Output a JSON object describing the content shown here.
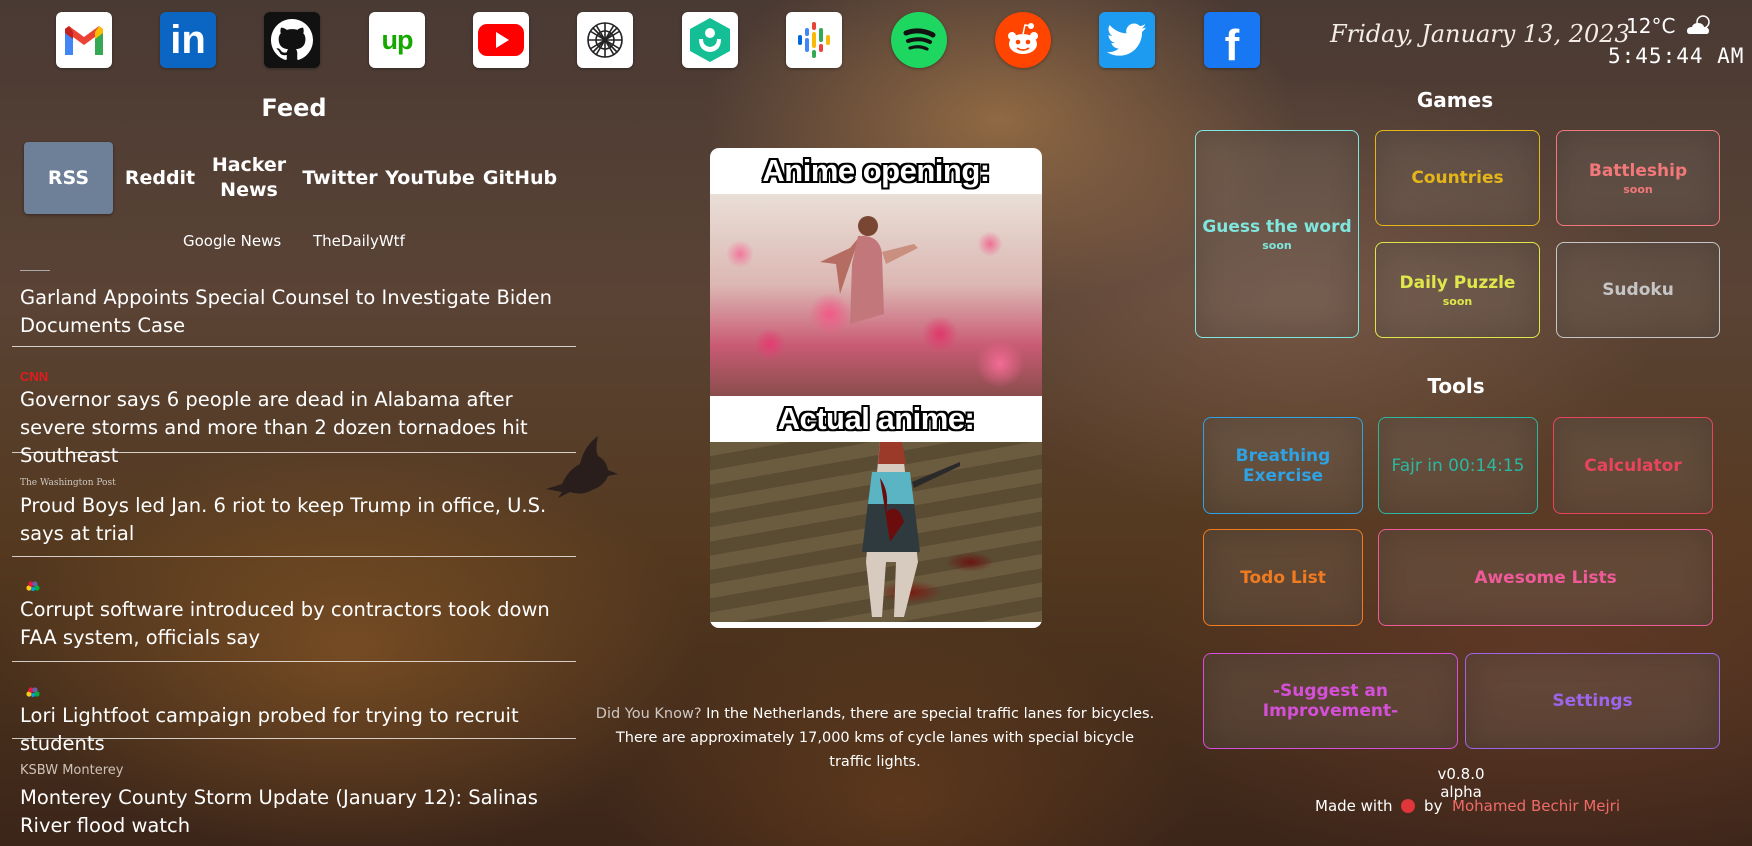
{
  "top_bar": {
    "apps": [
      {
        "name": "Gmail",
        "icon": "gmail-icon"
      },
      {
        "name": "LinkedIn",
        "icon": "linkedin-icon"
      },
      {
        "name": "GitHub",
        "icon": "github-icon"
      },
      {
        "name": "Upwork",
        "icon": "upwork-icon"
      },
      {
        "name": "YouTube",
        "icon": "youtube-icon"
      },
      {
        "name": "OpenAI",
        "icon": "openai-icon"
      },
      {
        "name": "Khan Academy",
        "icon": "khan-academy-icon"
      },
      {
        "name": "Google Podcasts",
        "icon": "google-podcasts-icon"
      },
      {
        "name": "Spotify",
        "icon": "spotify-icon"
      },
      {
        "name": "Reddit",
        "icon": "reddit-icon"
      },
      {
        "name": "Twitter",
        "icon": "twitter-icon"
      },
      {
        "name": "Facebook",
        "icon": "facebook-icon"
      }
    ],
    "upwork_glyph": "up",
    "linkedin_glyph": "in",
    "facebook_glyph": "f",
    "gmail_glyph": "M",
    "date": "Friday, January 13, 2023",
    "temperature": "12°C",
    "weather_icon": "partly-cloudy-icon",
    "time": "5:45:44 AM"
  },
  "feed": {
    "title": "Feed",
    "tabs": [
      "RSS",
      "Reddit",
      "Hacker News",
      "Twitter",
      "YouTube",
      "GitHub"
    ],
    "active_tab": "RSS",
    "subtabs": [
      "Google News",
      "TheDailyWtf"
    ],
    "items": [
      {
        "source": "",
        "title": "Garland Appoints Special Counsel to Investigate Biden Documents Case"
      },
      {
        "source": "CNN",
        "title": "Governor says 6 people are dead in Alabama after severe storms and more than 2 dozen tornadoes hit Southeast"
      },
      {
        "source": "The Washington Post",
        "title": "Proud Boys led Jan. 6 riot to keep Trump in office, U.S. says at trial"
      },
      {
        "source": "",
        "title": "Corrupt software introduced by contractors took down FAA system, officials say"
      },
      {
        "source": "",
        "title": "Lori Lightfoot campaign probed for trying to recruit students"
      },
      {
        "source": "KSBW Monterey",
        "title": "Monterey County Storm Update (January 12): Salinas River flood watch"
      }
    ]
  },
  "meme": {
    "top_caption": "Anime opening:",
    "bottom_caption": "Actual anime:"
  },
  "did_you_know": {
    "label": "Did You Know?",
    "text_line1": "In the Netherlands, there are special traffic lanes for bicycles.",
    "text_line2": "There are approximately 17,000 kms of cycle lanes with special bicycle",
    "text_line3": "traffic lights."
  },
  "games": {
    "title": "Games",
    "items": [
      {
        "label": "Guess the word",
        "badge": "soon",
        "color": "#7fe7dd"
      },
      {
        "label": "Countries",
        "badge": "",
        "color": "#e5b619"
      },
      {
        "label": "Battleship",
        "badge": "soon",
        "color": "#f2787a"
      },
      {
        "label": "Daily Puzzle",
        "badge": "soon",
        "color": "#dfe84a"
      },
      {
        "label": "Sudoku",
        "badge": "",
        "color": "#c6c6c6"
      }
    ]
  },
  "tools": {
    "title": "Tools",
    "items": [
      {
        "label": "Breathing Exercise",
        "color": "#2ea2e3"
      },
      {
        "label": "Fajr in 00:14:15",
        "color": "#2bb7a0"
      },
      {
        "label": "Calculator",
        "color": "#e8455c"
      },
      {
        "label": "Todo List",
        "color": "#f07b20"
      },
      {
        "label": "Awesome Lists",
        "color": "#ef5a98"
      },
      {
        "label": "-Suggest an Improvement-",
        "color": "#d54fd9"
      },
      {
        "label": "Settings",
        "color": "#9b66ea"
      }
    ]
  },
  "footer": {
    "version": "v0.8.0 alpha",
    "made_with": "Made with",
    "by": "by",
    "author": "Mohamed Bechir Mejri"
  }
}
